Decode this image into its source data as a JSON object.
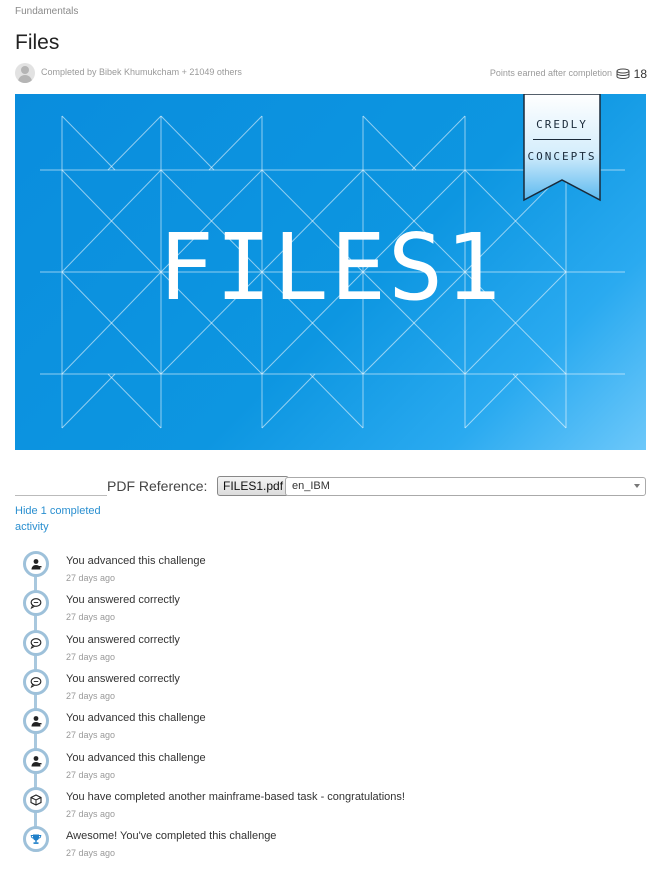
{
  "breadcrumb": "Fundamentals",
  "title": "Files",
  "completed_by": "Completed by Bibek Khumukcham + 21049 others",
  "points_label": "Points earned after completion",
  "points_value": "18",
  "banner": {
    "text": "FILES1",
    "ribbon_line1": "CREDLY",
    "ribbon_line2": "CONCEPTS",
    "colors": {
      "primary": "#0d96e1",
      "light": "#6dc8fa"
    }
  },
  "pdf": {
    "label": "PDF Reference:",
    "button": "FILES1.pdf",
    "language": "en_IBM"
  },
  "hide_link": "Hide 1 completed activity",
  "activities": [
    {
      "icon": "person-icon",
      "text": "You advanced this challenge",
      "time": "27 days ago"
    },
    {
      "icon": "chat-icon",
      "text": "You answered correctly",
      "time": "27 days ago"
    },
    {
      "icon": "chat-icon",
      "text": "You answered correctly",
      "time": "27 days ago"
    },
    {
      "icon": "chat-icon",
      "text": "You answered correctly",
      "time": "27 days ago"
    },
    {
      "icon": "person-icon",
      "text": "You advanced this challenge",
      "time": "27 days ago"
    },
    {
      "icon": "person-icon",
      "text": "You advanced this challenge",
      "time": "27 days ago"
    },
    {
      "icon": "cube-icon",
      "text": "You have completed another mainframe-based task - congratulations!",
      "time": "27 days ago"
    },
    {
      "icon": "trophy-icon",
      "text": "Awesome! You've completed this challenge",
      "time": "27 days ago"
    }
  ]
}
